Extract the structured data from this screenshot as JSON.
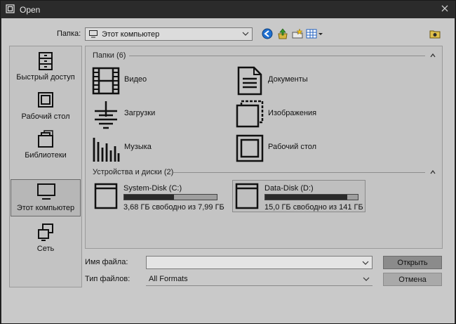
{
  "window": {
    "title": "Open"
  },
  "lookin": {
    "label": "Папка:",
    "value": "Этот компьютер"
  },
  "places": [
    {
      "label": "Быстрый доступ",
      "icon": "quick-access-icon"
    },
    {
      "label": "Рабочий стол",
      "icon": "desktop-icon"
    },
    {
      "label": "Библиотеки",
      "icon": "libraries-icon"
    },
    {
      "label": "Этот компьютер",
      "icon": "this-pc-icon",
      "selected": true
    },
    {
      "label": "Сеть",
      "icon": "network-icon"
    }
  ],
  "folders_group": {
    "header": "Папки (6)",
    "items": [
      {
        "label": "Видео",
        "icon": "video-icon"
      },
      {
        "label": "Документы",
        "icon": "documents-icon"
      },
      {
        "label": "Загрузки",
        "icon": "downloads-icon"
      },
      {
        "label": "Изображения",
        "icon": "pictures-icon"
      },
      {
        "label": "Музыка",
        "icon": "music-icon"
      },
      {
        "label": "Рабочий стол",
        "icon": "desktop-folder-icon"
      }
    ]
  },
  "drives_group": {
    "header": "Устройства и диски (2)",
    "items": [
      {
        "name": "System-Disk (C:)",
        "free": "3,68 ГБ свободно из 7,99 ГБ",
        "used_fraction": 0.54
      },
      {
        "name": "Data-Disk (D:)",
        "free": "15,0 ГБ свободно из 141 ГБ",
        "used_fraction": 0.89,
        "selected": true
      }
    ]
  },
  "filename": {
    "label": "Имя файла:",
    "value": ""
  },
  "filetype": {
    "label": "Тип файлов:",
    "value": "All Formats"
  },
  "buttons": {
    "open": "Открыть",
    "cancel": "Отмена"
  },
  "colors": {
    "dark": "#2b2b2b",
    "panel": "#c9c9c9",
    "accent_blue": "#1f6fd0",
    "accent_green": "#3a9a2a"
  }
}
